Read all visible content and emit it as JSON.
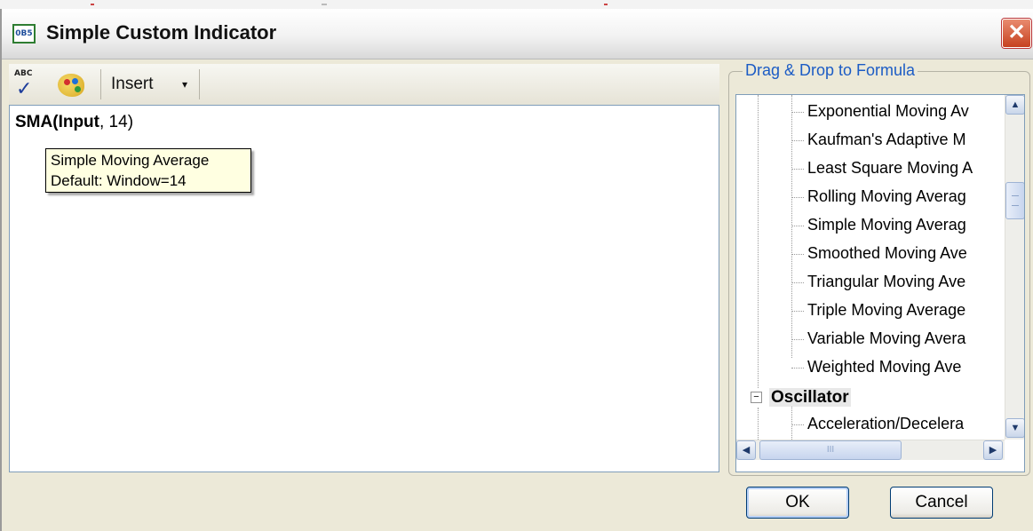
{
  "window": {
    "title": "Simple Custom Indicator",
    "icon_text": "0B5",
    "close_glyph": "✕"
  },
  "toolbar": {
    "spell_abc": "ABC",
    "insert_label": "Insert",
    "insert_arrow": "▾"
  },
  "editor": {
    "func": "SMA",
    "open_paren": "(",
    "arg_bold": "Input",
    "rest": ", 14)"
  },
  "tooltip": {
    "line1": "Simple Moving Average",
    "line2": "Default: Window=14"
  },
  "panel": {
    "label": "Drag & Drop to Formula",
    "items": [
      "Exponential Moving Av",
      "Kaufman's Adaptive M",
      "Least Square Moving A",
      "Rolling Moving Averag",
      "Simple Moving Averag",
      "Smoothed Moving Ave",
      "Triangular Moving Ave",
      "Triple Moving Average",
      "Variable Moving Avera",
      "Weighted Moving Ave"
    ],
    "category": "Oscillator",
    "category_toggle": "−",
    "category_items": [
      "Acceleration/Decelera"
    ]
  },
  "scroll": {
    "up": "▲",
    "down": "▼",
    "left": "◀",
    "right": "▶",
    "hgrip": "III"
  },
  "buttons": {
    "ok": "OK",
    "cancel": "Cancel"
  }
}
